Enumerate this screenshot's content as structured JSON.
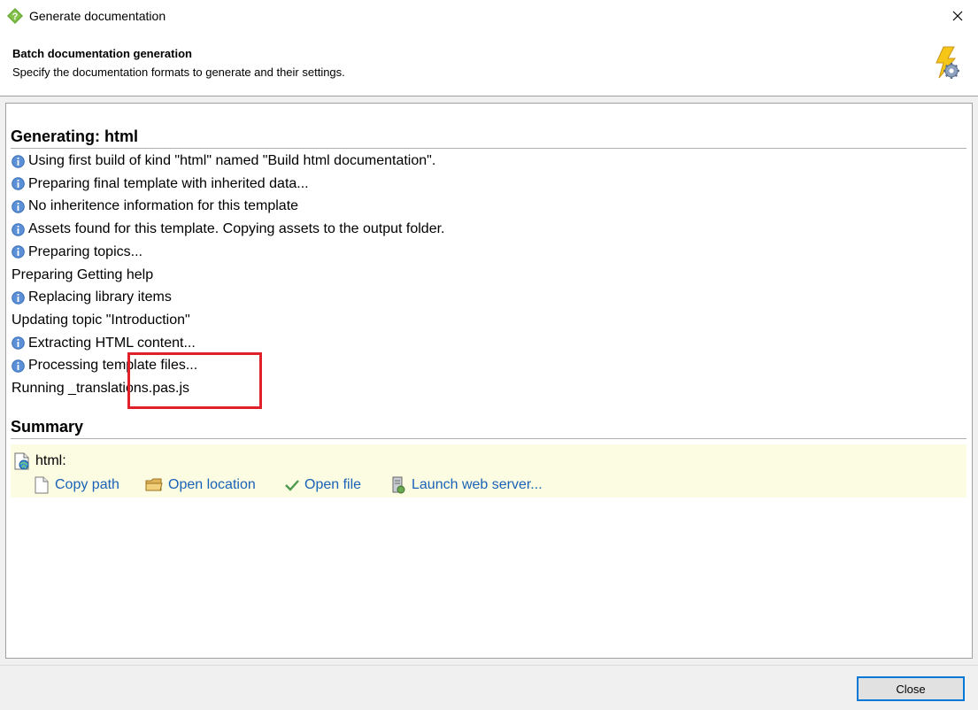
{
  "window": {
    "title": "Generate documentation",
    "close_icon": "close-icon"
  },
  "header": {
    "title": "Batch documentation generation",
    "subtitle": "Specify the documentation formats to generate and their settings.",
    "icon": "lightning-gear-icon"
  },
  "log": {
    "heading": "Generating: html",
    "lines": [
      {
        "text": "Using first build of kind \"html\" named \"Build html documentation\".",
        "icon": "info-icon"
      },
      {
        "text": "Preparing final template with inherited data...",
        "icon": "info-icon"
      },
      {
        "text": "No inheritence information for this template",
        "icon": "info-icon"
      },
      {
        "text": "Assets found for this template. Copying assets to the output folder.",
        "icon": "info-icon"
      },
      {
        "text": "Preparing topics...",
        "icon": "info-icon"
      },
      {
        "text": "Preparing Getting help",
        "icon": ""
      },
      {
        "text": "Replacing library items",
        "icon": "info-icon"
      },
      {
        "text": "Updating topic \"Introduction\"",
        "icon": ""
      },
      {
        "text": "Extracting HTML content...",
        "icon": "info-icon"
      },
      {
        "text": "Processing template files...",
        "icon": "info-icon"
      },
      {
        "text": "Running _translations.pas.js",
        "icon": ""
      }
    ]
  },
  "summary": {
    "heading": "Summary",
    "output_label": "html:",
    "actions": {
      "copy_path": "Copy path",
      "open_location": "Open location",
      "open_file": "Open file",
      "launch_server": "Launch web server..."
    }
  },
  "footer": {
    "close_label": "Close"
  },
  "colors": {
    "link": "#1a62b8",
    "summary_bg": "#fcfce2",
    "highlight": "#e0202a",
    "info_icon": "#5b8fd6"
  }
}
